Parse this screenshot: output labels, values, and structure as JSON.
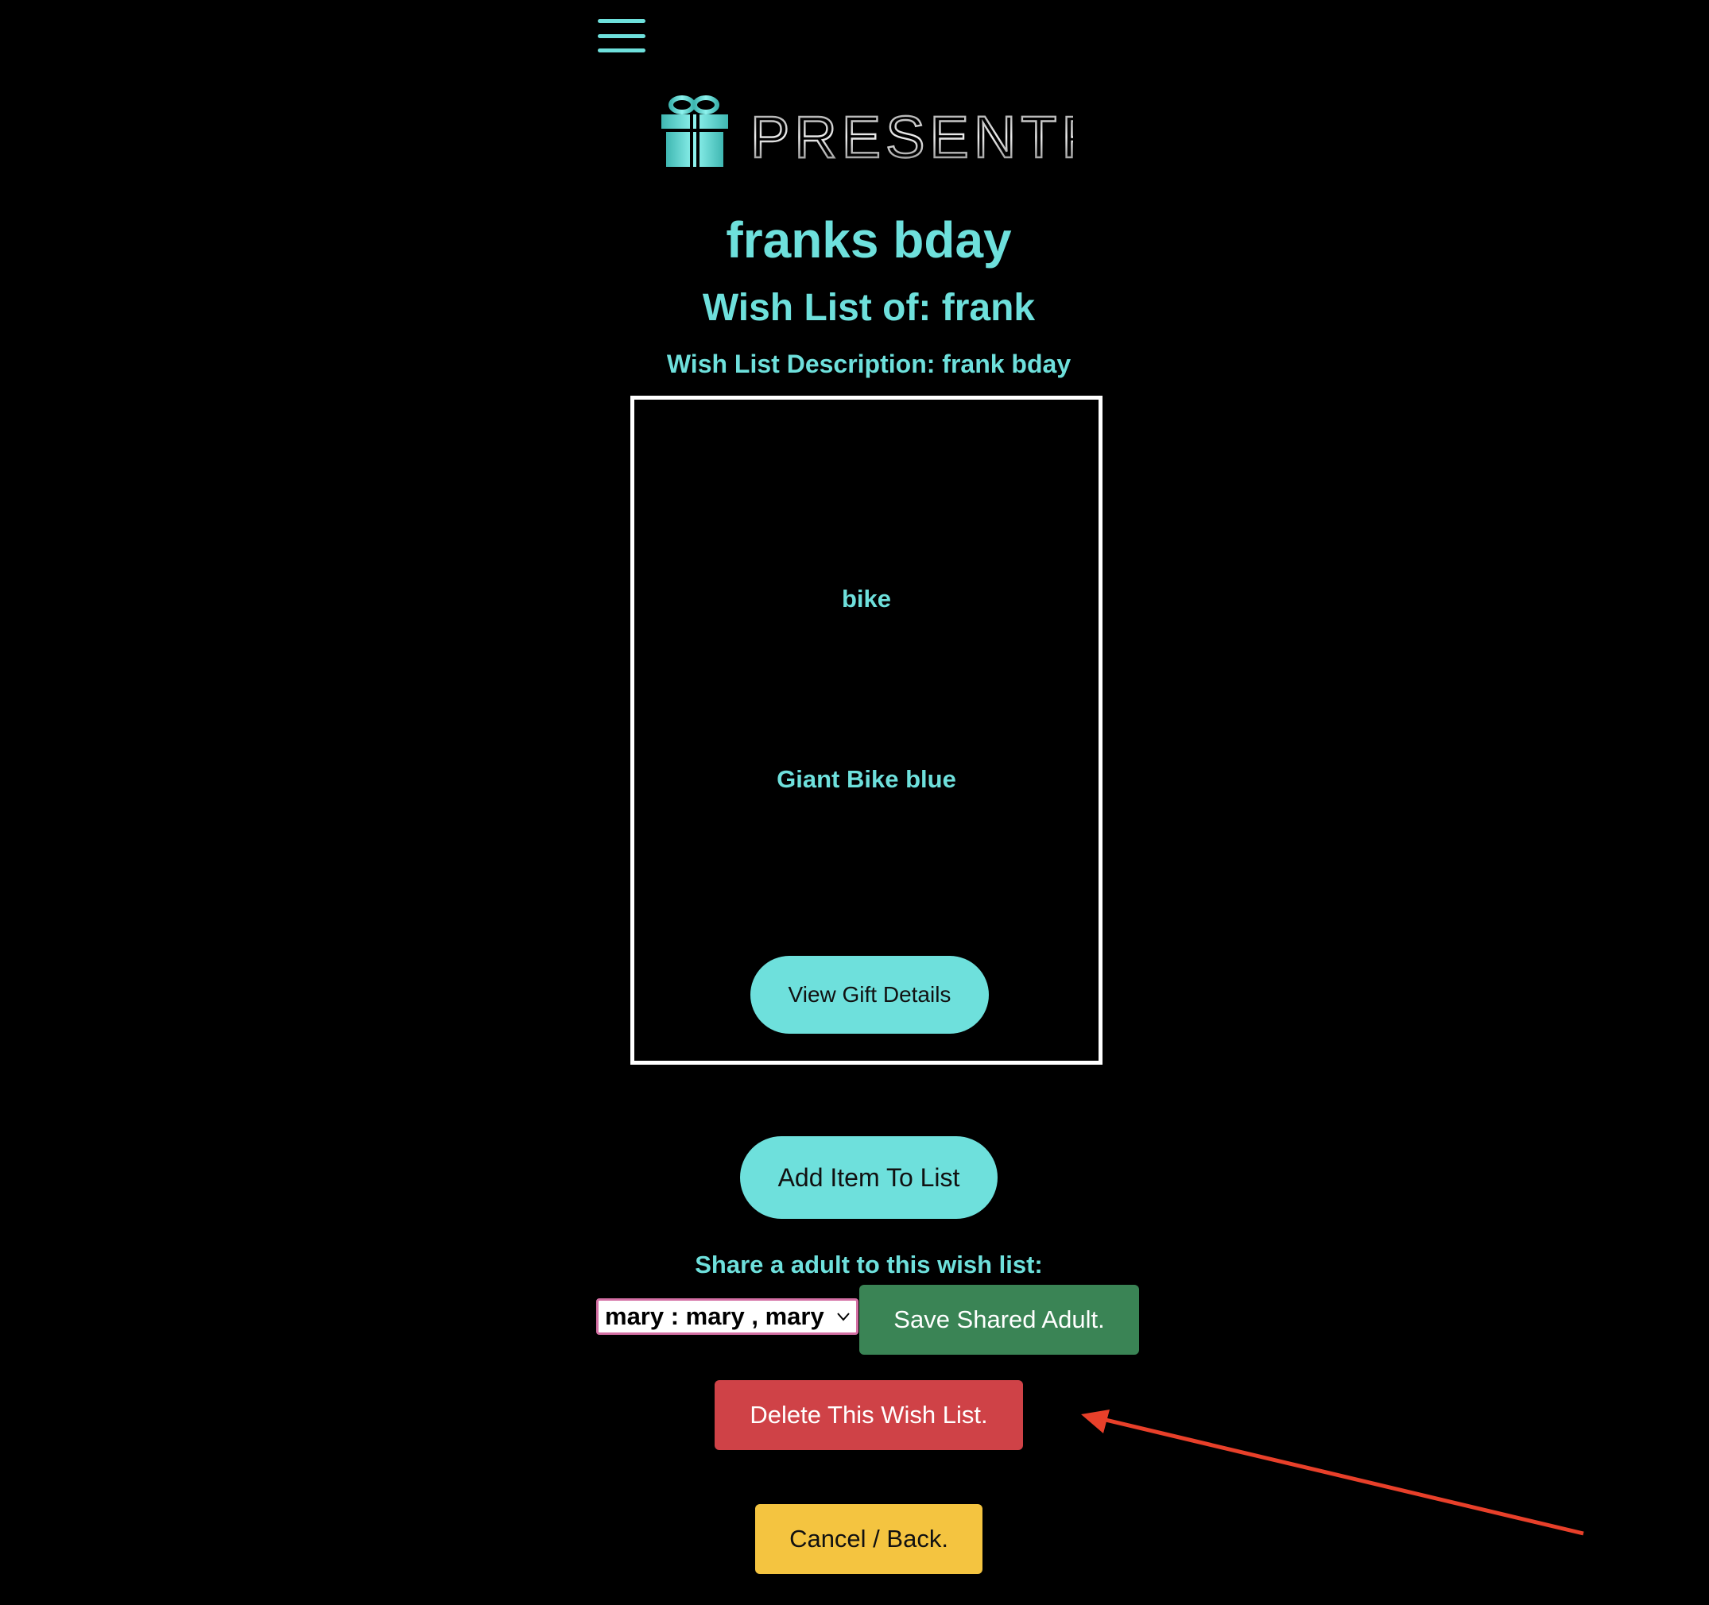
{
  "header": {
    "menu_icon": "hamburger-menu-icon",
    "logo_icon": "gift-box-icon",
    "logo_text": "PRESENTPALS"
  },
  "wishlist": {
    "title": "franks bday",
    "owner_line": "Wish List of: frank",
    "description_line": "Wish List Description: frank bday"
  },
  "gift": {
    "name": "bike",
    "description": "Giant Bike blue",
    "details_button": "View Gift Details"
  },
  "actions": {
    "add_item_button": "Add Item To List",
    "share_label": "Share a adult to this wish list:",
    "share_selected": "mary : mary , mary",
    "save_shared_button": "Save Shared Adult.",
    "delete_button": "Delete This Wish List.",
    "cancel_button": "Cancel / Back."
  },
  "colors": {
    "background": "#000000",
    "accent_teal": "#6ee0dc",
    "save_green": "#3a8455",
    "delete_red": "#cf4247",
    "cancel_yellow": "#f4c440",
    "annotation_arrow": "#e8402a"
  }
}
